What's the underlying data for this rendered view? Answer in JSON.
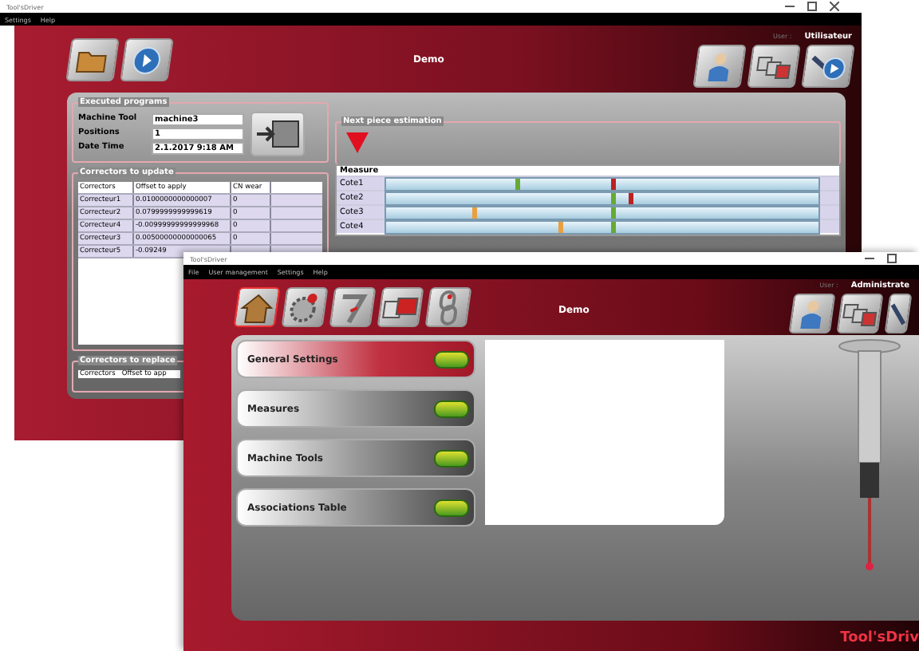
{
  "back_window": {
    "title": "Tool'sDriver",
    "menu": [
      "Settings",
      "Help"
    ],
    "header": {
      "title": "Demo",
      "user_label": "User :",
      "user_name": "Utilisateur"
    },
    "executed_programs": {
      "legend": "Executed programs",
      "fields": [
        {
          "label": "Machine Tool",
          "value": "machine3"
        },
        {
          "label": "Positions",
          "value": "1"
        },
        {
          "label": "Date Time",
          "value": "2.1.2017 9:18 AM"
        }
      ]
    },
    "correctors_to_update": {
      "legend": "Correctors to update",
      "columns": [
        "Correctors",
        "Offset to apply",
        "CN wear"
      ],
      "rows": [
        [
          "Correcteur1",
          "0.0100000000000007",
          "0"
        ],
        [
          "Correcteur2",
          "0.0799999999999619",
          "0"
        ],
        [
          "Correcteur4",
          "-0.00999999999999968",
          "0"
        ],
        [
          "Correcteur3",
          "0.00500000000000065",
          "0"
        ],
        [
          "Correcteur5",
          "-0.09249",
          ""
        ]
      ]
    },
    "next_piece_estimation": {
      "legend": "Next piece estimation",
      "column": "Measure",
      "rows": [
        "Cote1",
        "Cote2",
        "Cote3",
        "Cote4"
      ]
    },
    "correctors_to_replace": {
      "legend": "Correctors to replace",
      "columns": [
        "Correctors",
        "Offset to app"
      ]
    }
  },
  "front_window": {
    "title": "Tool'sDriver",
    "menu": [
      "File",
      "User management",
      "Settings",
      "Help"
    ],
    "header": {
      "title": "Demo",
      "user_label": "User :",
      "user_name": "Administrate"
    },
    "nav_items": [
      {
        "label": "General Settings",
        "selected": true,
        "on": true
      },
      {
        "label": "Measures",
        "selected": false,
        "on": true
      },
      {
        "label": "Machine Tools",
        "selected": false,
        "on": true
      },
      {
        "label": "Associations Table",
        "selected": false,
        "on": true
      }
    ],
    "logo": "Tool'sDriv"
  }
}
